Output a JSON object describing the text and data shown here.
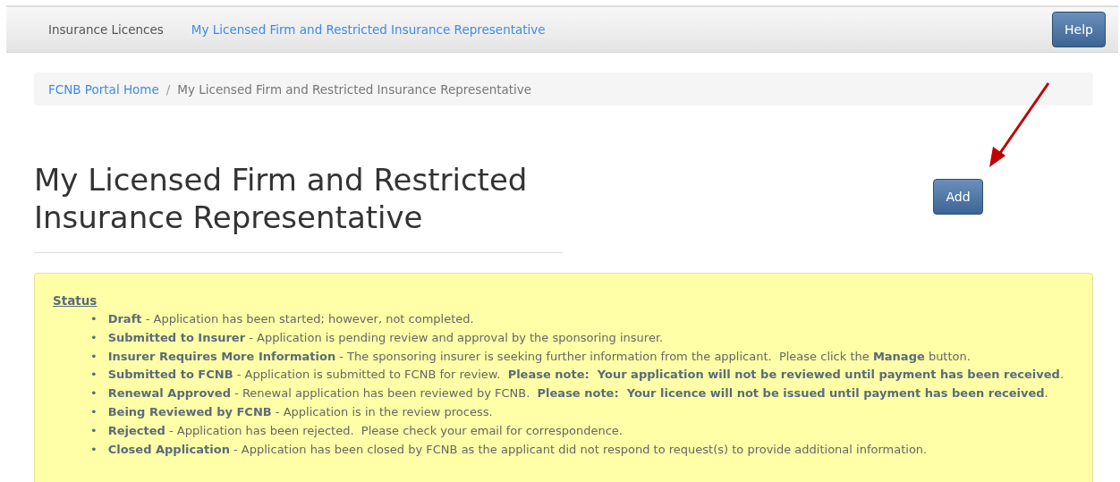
{
  "navbar": {
    "items": [
      {
        "label": "Insurance Licences",
        "selected": false
      },
      {
        "label": "My Licensed Firm and Restricted Insurance Representative",
        "selected": true
      }
    ],
    "help_button": "Help"
  },
  "breadcrumb": {
    "link": "FCNB Portal Home",
    "separator": "/",
    "current": "My Licensed Firm and Restricted Insurance Representative"
  },
  "page_title": "My Licensed Firm and Restricted Insurance Representative",
  "add_button": "Add",
  "status_box": {
    "heading": "Status",
    "items": [
      {
        "bullet": "•",
        "text": "**Draft** - Application has been started; however, not completed."
      },
      {
        "bullet": "•",
        "text": "**Submitted to Insurer** - Application is pending review and approval by the sponsoring insurer."
      },
      {
        "bullet": "•",
        "text": "**Insurer Requires More Information** - The sponsoring insurer is seeking further information from the applicant.  Please click the **Manage** button."
      },
      {
        "bullet": "•",
        "text": "**Submitted to FCNB** - Application is submitted to FCNB for review.  **Please note:  Your application will not be reviewed until payment has been received**."
      },
      {
        "bullet": "•",
        "text": "**Renewal Approved** - Renewal application has been reviewed by FCNB.  **Please note:  Your licence will not be issued until payment has been received**."
      },
      {
        "bullet": "•",
        "text": "**Being Reviewed by FCNB** - Application is in the review process."
      },
      {
        "bullet": "•",
        "text": "**Rejected** - Application has been rejected.  Please check your email for correspondence."
      },
      {
        "bullet": "•",
        "text": "**Closed Application** - Application has been closed by FCNB as the applicant did not respond to request(s) to provide additional information."
      }
    ]
  }
}
